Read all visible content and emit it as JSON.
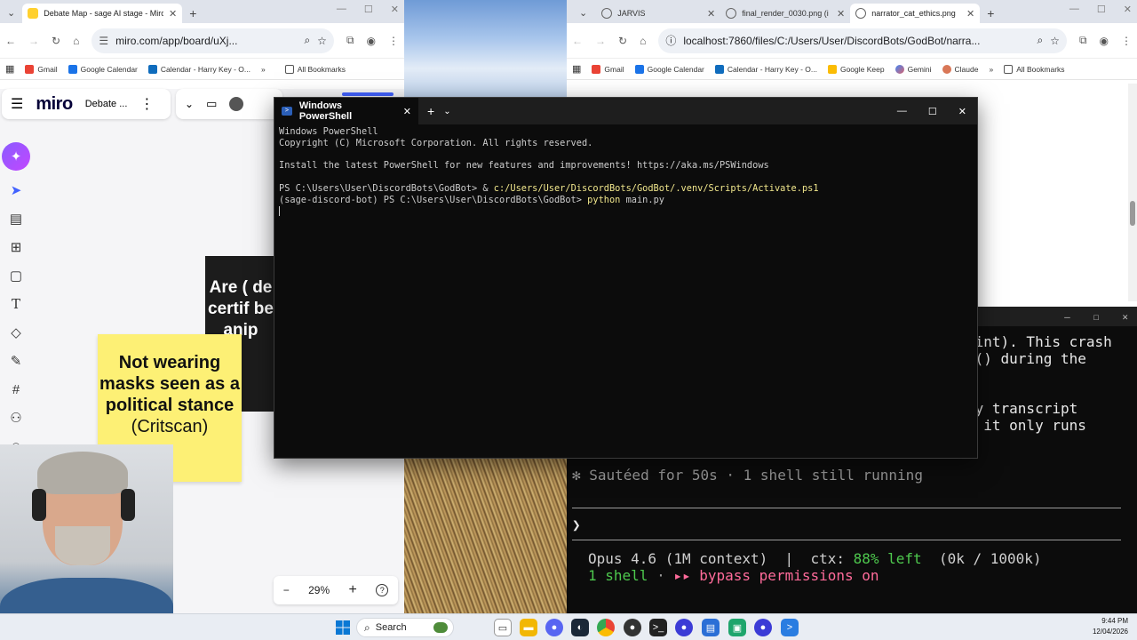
{
  "left_browser": {
    "tabs": [
      {
        "title": "Debate Map - sage AI stage - Miro",
        "active": true
      }
    ],
    "url": "miro.com/app/board/uXj...",
    "bookmarks": [
      "Gmail",
      "Google Calendar",
      "Calendar - Harry Key - O...",
      "All Bookmarks"
    ]
  },
  "miro": {
    "logo": "miro",
    "board_name": "Debate ...",
    "sticky_dark_text": "Are ( de certif be anip",
    "sticky_yellow": {
      "bold": "Not wearing masks seen as a political stance",
      "source": "(Critscan)"
    },
    "zoom": "29%",
    "zoom_minus": "−",
    "zoom_plus": "+",
    "help": "?"
  },
  "right_browser": {
    "tabs": [
      {
        "title": "JARVIS",
        "active": false
      },
      {
        "title": "final_render_0030.png (i",
        "active": false
      },
      {
        "title": "narrator_cat_ethics.png",
        "active": true
      }
    ],
    "url": "localhost:7860/files/C:/Users/User/DiscordBots/GodBot/narra...",
    "bookmarks": [
      "Gmail",
      "Google Calendar",
      "Calendar - Harry Key - O...",
      "Google Keep",
      "Gemini",
      "Claude",
      "All Bookmarks"
    ]
  },
  "claude_terminal": {
    "line1": "oint). This crash",
    "line2": "o() during the",
    "line3": "ly transcript",
    "line4": "— it only runs",
    "status": "✻ Sautéed for 50s · 1 shell still running",
    "prompt": "❯",
    "model_line_a": "Opus 4.6 (1M context)  |  ctx: ",
    "ctx_pct": "88% left",
    "model_line_b": "  (0k / 1000k)",
    "shell_count": "1 shell",
    "sep": " · ",
    "bypass": "▸▸ bypass permissions on"
  },
  "powershell": {
    "tab_title": "Windows PowerShell",
    "lines": {
      "l1": "Windows PowerShell",
      "l2": "Copyright (C) Microsoft Corporation. All rights reserved.",
      "l3": "Install the latest PowerShell for new features and improvements! https://aka.ms/PSWindows",
      "l4_prompt": "PS C:\\Users\\User\\DiscordBots\\GodBot> ",
      "l4_amp": "& ",
      "l4_cmd": "c:/Users/User/DiscordBots/GodBot/.venv/Scripts/Activate.ps1",
      "l5_prompt": "(sage-discord-bot) PS C:\\Users\\User\\DiscordBots\\GodBot> ",
      "l5_cmd": "python",
      "l5_arg": " main.py"
    }
  },
  "taskbar": {
    "search_label": "Search",
    "time": "9:44 PM",
    "date": "12/04/2026"
  },
  "colors": {
    "accent_green": "#4ec94e",
    "bypass_pink": "#ff6b9a",
    "miro_yellow": "#fdf075"
  }
}
